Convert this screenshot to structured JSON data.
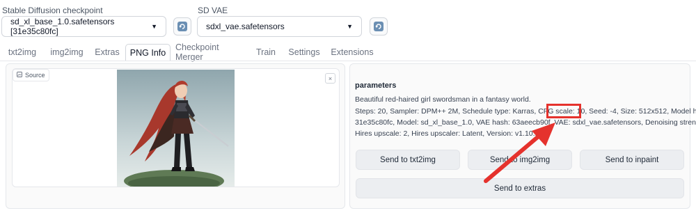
{
  "checkpoint": {
    "label": "Stable Diffusion checkpoint",
    "value": "sd_xl_base_1.0.safetensors [31e35c80fc]",
    "caret_icon": "chevron-down-icon",
    "refresh_icon": "refresh-icon"
  },
  "vae": {
    "label": "SD VAE",
    "value": "sdxl_vae.safetensors",
    "caret_icon": "chevron-down-icon",
    "refresh_icon": "refresh-icon"
  },
  "tabs": [
    {
      "label": "txt2img"
    },
    {
      "label": "img2img"
    },
    {
      "label": "Extras"
    },
    {
      "label": "PNG Info",
      "active": true
    },
    {
      "label": "Checkpoint Merger"
    },
    {
      "label": "Train"
    },
    {
      "label": "Settings"
    },
    {
      "label": "Extensions"
    }
  ],
  "source": {
    "label": "Source",
    "image_icon": "image-icon",
    "close_label": "×"
  },
  "parameters": {
    "title": "parameters",
    "prompt": "Beautiful red-haired girl swordsman in a fantasy world.",
    "line1": "Steps: 20, Sampler: DPM++ 2M, Schedule type: Karras, CFG scale: 10, Seed: -4, Size: 512x512, Model hash:",
    "line2": "31e35c80fc, Model: sd_xl_base_1.0, VAE hash: 63aeecb90f, VAE: sdxl_vae.safetensors, Denoising strength: 0.7,",
    "line3": "Hires upscale: 2, Hires upscaler: Latent, Version: v1.10.1"
  },
  "buttons": {
    "txt2img": "Send to txt2img",
    "img2img": "Send to img2img",
    "inpaint": "Send to inpaint",
    "extras": "Send to extras"
  },
  "annotation": {
    "highlight_color": "#e5322d",
    "arrow_color": "#e5322d"
  }
}
